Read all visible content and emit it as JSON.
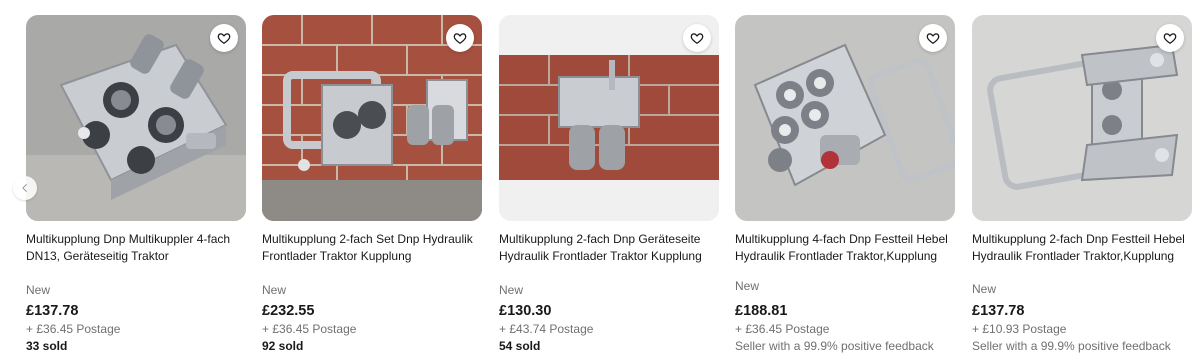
{
  "listings": [
    {
      "title": "Multikupplung Dnp Multikuppler 4-fach DN13, Geräteseitig Traktor",
      "condition": "New",
      "price": "£137.78",
      "postage": "+ £36.45 Postage",
      "extra": "33 sold",
      "extra_type": "sold"
    },
    {
      "title": "Multikupplung 2-fach Set Dnp Hydraulik Frontlader Traktor Kupplung",
      "condition": "New",
      "price": "£232.55",
      "postage": "+ £36.45 Postage",
      "extra": "92 sold",
      "extra_type": "sold"
    },
    {
      "title": "Multikupplung 2-fach Dnp Geräteseite Hydraulik Frontlader Traktor Kupplung",
      "condition": "New",
      "price": "£130.30",
      "postage": "+ £43.74 Postage",
      "extra": "54 sold",
      "extra_type": "sold"
    },
    {
      "title": "Multikupplung 4-fach Dnp Festteil Hebel Hydraulik Frontlader Traktor,Kupplung",
      "condition": "New",
      "price": "£188.81",
      "postage": "+ £36.45 Postage",
      "extra": "Seller with a 99.9% positive feedback",
      "extra_type": "seller"
    },
    {
      "title": "Multikupplung 2-fach Dnp Festteil Hebel Hydraulik Frontlader Traktor,Kupplung",
      "condition": "New",
      "price": "£137.78",
      "postage": "+ £10.93 Postage",
      "extra": "Seller with a 99.9% positive feedback",
      "extra_type": "seller"
    }
  ],
  "icons": {
    "favorite": "heart-icon",
    "previous": "chevron-left-icon"
  },
  "colors": {
    "text": "#191919",
    "muted": "#707070",
    "image_bg": "#f0f0f0"
  }
}
